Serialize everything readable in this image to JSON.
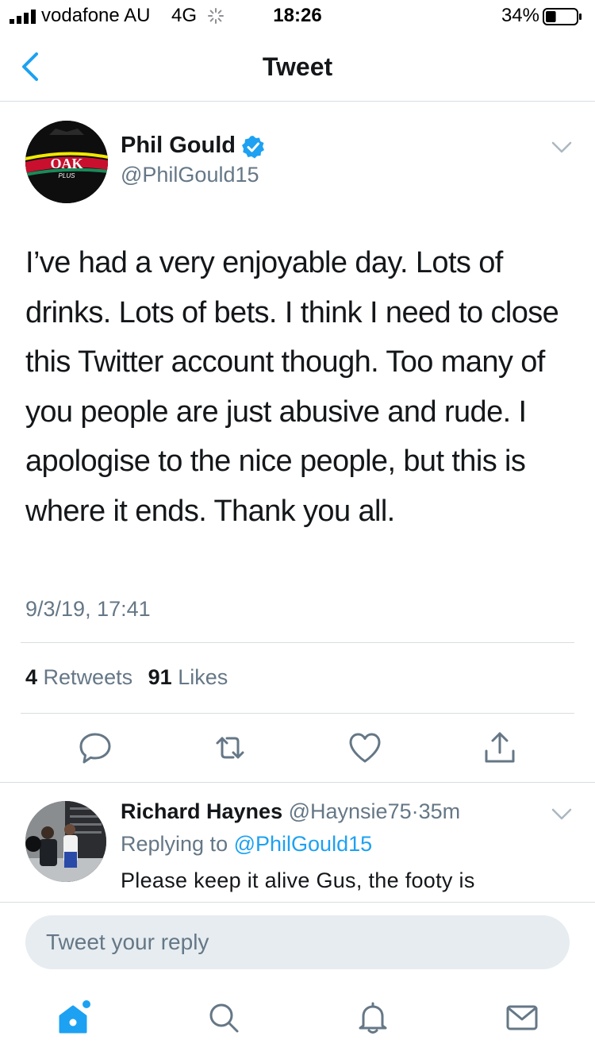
{
  "status_bar": {
    "carrier": "vodafone AU",
    "network": "4G",
    "time": "18:26",
    "battery": "34%",
    "battery_level": 0.34
  },
  "nav": {
    "title": "Tweet",
    "back_icon": "chevron-left-icon"
  },
  "tweet": {
    "author_name": "Phil Gould",
    "verified": true,
    "handle": "@PhilGould15",
    "text": "I’ve had a very enjoyable day. Lots of drinks. Lots of bets. I think I need to close this Twitter account though. Too many of you people are just abusive and rude. I apologise to the nice people, but this is where it ends. Thank you all.",
    "timestamp": "9/3/19, 17:41",
    "retweets_count": "4",
    "retweets_label": "Retweets",
    "likes_count": "91",
    "likes_label": "Likes",
    "avatar_text": "OAK",
    "avatar_subtext": "PLUS"
  },
  "actions": [
    "reply-icon",
    "retweet-icon",
    "like-icon",
    "share-icon"
  ],
  "reply": {
    "author_name": "Richard Haynes",
    "handle": "@Haynsie75",
    "separator": "·",
    "time": "35m",
    "replying_label": "Replying to",
    "replying_to": "@PhilGould15",
    "text": "Please keep it alive Gus, the footy is"
  },
  "composer": {
    "placeholder": "Tweet your reply"
  },
  "tab_bar": [
    "home-icon",
    "search-icon",
    "notifications-icon",
    "messages-icon"
  ],
  "colors": {
    "accent": "#1da1f2",
    "secondary_text": "#657786",
    "primary_text": "#14171a",
    "divider": "#d8dde1"
  }
}
